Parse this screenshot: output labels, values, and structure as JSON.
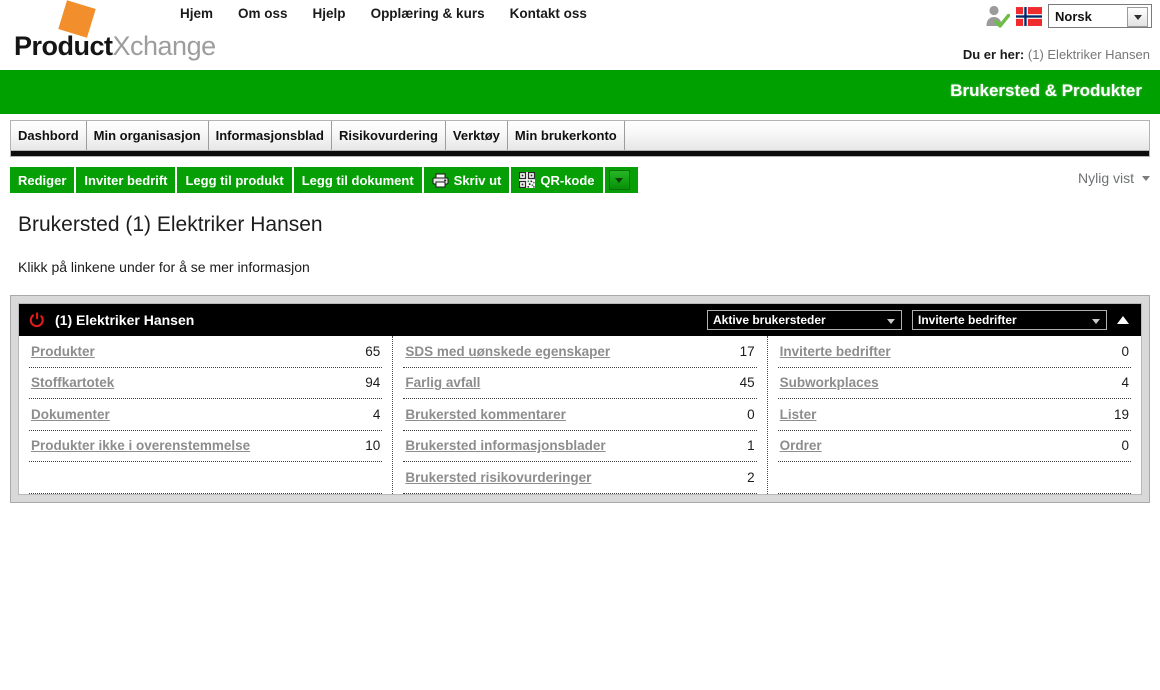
{
  "header": {
    "logo_bold": "Product",
    "logo_light": "Xchange",
    "nav": [
      {
        "label": "Hjem"
      },
      {
        "label": "Om oss"
      },
      {
        "label": "Hjelp"
      },
      {
        "label": "Opplæring & kurs"
      },
      {
        "label": "Kontakt oss"
      }
    ],
    "user_icon": "user-check-icon",
    "flag_icon": "norway-flag-icon",
    "language": {
      "value": "Norsk",
      "caret_icon": "chevron-down-icon"
    },
    "breadcrumb": {
      "label": "Du er her:",
      "value": "(1) Elektriker Hansen"
    }
  },
  "banner": {
    "title": "Brukersted & Produkter",
    "color": "#00A000"
  },
  "tabs": [
    {
      "label": "Dashbord"
    },
    {
      "label": "Min organisasjon"
    },
    {
      "label": "Informasjonsblad"
    },
    {
      "label": "Risikovurdering"
    },
    {
      "label": "Verktøy"
    },
    {
      "label": "Min brukerkonto"
    }
  ],
  "toolbar": {
    "buttons": [
      {
        "label": "Rediger",
        "icon": null
      },
      {
        "label": "Inviter bedrift",
        "icon": null
      },
      {
        "label": "Legg til produkt",
        "icon": null
      },
      {
        "label": "Legg til dokument",
        "icon": null
      },
      {
        "label": "Skriv ut",
        "icon": "printer-icon"
      },
      {
        "label": "QR-kode",
        "icon": "qr-code-icon"
      }
    ],
    "dropdown_icon": "chevron-down-icon",
    "recent_label": "Nylig vist",
    "recent_caret_icon": "chevron-down-icon"
  },
  "page": {
    "title": "Brukersted (1) Elektriker Hansen",
    "subtitle": "Klikk på linkene under for å se mer informasjon"
  },
  "panel": {
    "head_icon": "power-refresh-icon",
    "head_title": "(1) Elektriker Hansen",
    "select_left": "Aktive brukersteder",
    "select_right": "Inviterte bedrifter",
    "collapse_icon": "triangle-up-icon",
    "columns": [
      {
        "rows": [
          {
            "label": "Produkter",
            "count": "65"
          },
          {
            "label": "Stoffkartotek",
            "count": "94"
          },
          {
            "label": "Dokumenter",
            "count": "4"
          },
          {
            "label": "Produkter ikke i overenstemmelse",
            "count": "10"
          },
          {
            "label": "",
            "count": ""
          }
        ]
      },
      {
        "rows": [
          {
            "label": "SDS med uønskede egenskaper",
            "count": "17"
          },
          {
            "label": "Farlig avfall",
            "count": "45"
          },
          {
            "label": "Brukersted kommentarer",
            "count": "0"
          },
          {
            "label": "Brukersted informasjonsblader",
            "count": "1"
          },
          {
            "label": "Brukersted risikovurderinger",
            "count": "2"
          }
        ]
      },
      {
        "rows": [
          {
            "label": "Inviterte bedrifter",
            "count": "0"
          },
          {
            "label": "Subworkplaces",
            "count": "4"
          },
          {
            "label": "Lister",
            "count": "19"
          },
          {
            "label": "Ordrer",
            "count": "0"
          },
          {
            "label": "",
            "count": ""
          }
        ]
      }
    ]
  }
}
